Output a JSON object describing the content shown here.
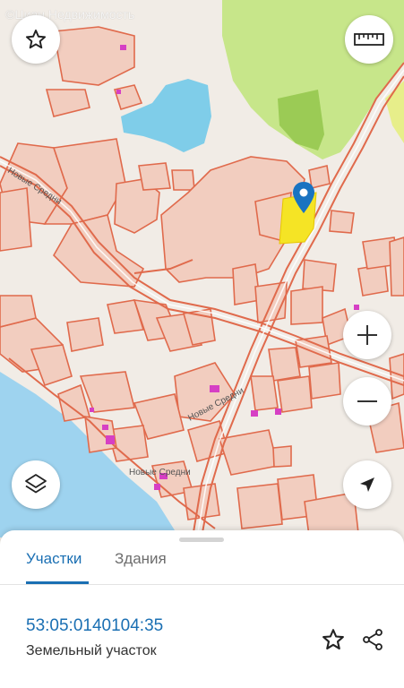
{
  "watermark": "©Циан.Недвижимость",
  "map": {
    "place_labels": [
      "Новые Средни",
      "Новые Средни",
      "Новые Средни"
    ],
    "colors": {
      "background": "#f1ece6",
      "parcel_fill": "#f2cdbf",
      "parcel_border": "#e06a4c",
      "water": "#9ed3ef",
      "lake": "#7fcde9",
      "forest": "#c7e68a",
      "forest_dark": "#9bcb55",
      "selected_parcel": "#f5e425",
      "building": "#d63fc4",
      "pin": "#1a73c1"
    }
  },
  "buttons": {
    "favorite_map": "star-icon",
    "ruler": "ruler-icon",
    "zoom_in": "plus-icon",
    "zoom_out": "minus-icon",
    "layers": "layers-icon",
    "location": "navigation-arrow-icon"
  },
  "panel": {
    "tabs": [
      {
        "label": "Участки",
        "active": true
      },
      {
        "label": "Здания",
        "active": false
      }
    ],
    "parcel": {
      "number": "53:05:0140104:35",
      "type": "Земельный участок"
    },
    "accent_color": "#1a6fb3"
  }
}
